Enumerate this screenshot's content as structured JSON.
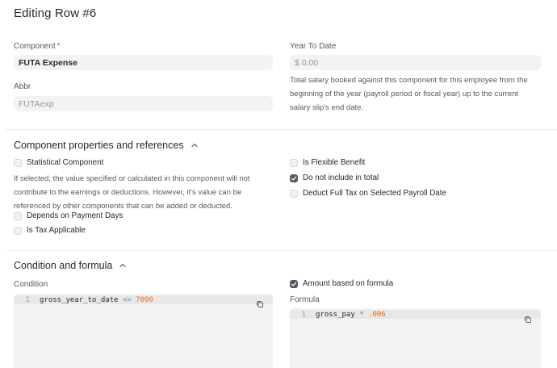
{
  "title": "Editing Row #6",
  "component": {
    "label": "Component",
    "required_mark": "*",
    "value": "FUTA Expense"
  },
  "abbr": {
    "label": "Abbr",
    "placeholder": "FUTAexp"
  },
  "ytd": {
    "label": "Year To Date",
    "value": "$ 0.00",
    "desc_lines": [
      "Total salary booked against this component for this employee from the",
      "beginning of the year (payroll period or fiscal year) up to the current",
      "salary slip's end date."
    ]
  },
  "props": {
    "heading": "Component properties and references",
    "statistical": "Statistical Component",
    "statistical_desc_lines": [
      "If selected, the value specified or calculated in this component will not",
      "contribute to the earnings or deductions. However, it's value can be",
      "referenced by other components that can be added or deducted."
    ],
    "depends_on_payment_days": "Depends on Payment Days",
    "is_tax_applicable": "Is Tax Applicable",
    "is_flexible_benefit": "Is Flexible Benefit",
    "do_not_include_in_total": "Do not include in total",
    "deduct_full_tax": "Deduct Full Tax on Selected Payroll Date"
  },
  "formula_section": {
    "heading": "Condition and formula",
    "condition_label": "Condition",
    "condition_line_no": "1",
    "condition_var": "gross_year_to_date",
    "condition_op": "<=",
    "condition_num": "7000",
    "amount_based_on_formula": "Amount based on formula",
    "formula_label": "Formula",
    "formula_line_no": "1",
    "formula_var": "gross_pay",
    "formula_op": "*",
    "formula_num": ".006"
  },
  "colors": {
    "checked": "#525a63",
    "operator": "#3e8fd3",
    "number": "#e86c13",
    "required": "#e24c4c"
  }
}
